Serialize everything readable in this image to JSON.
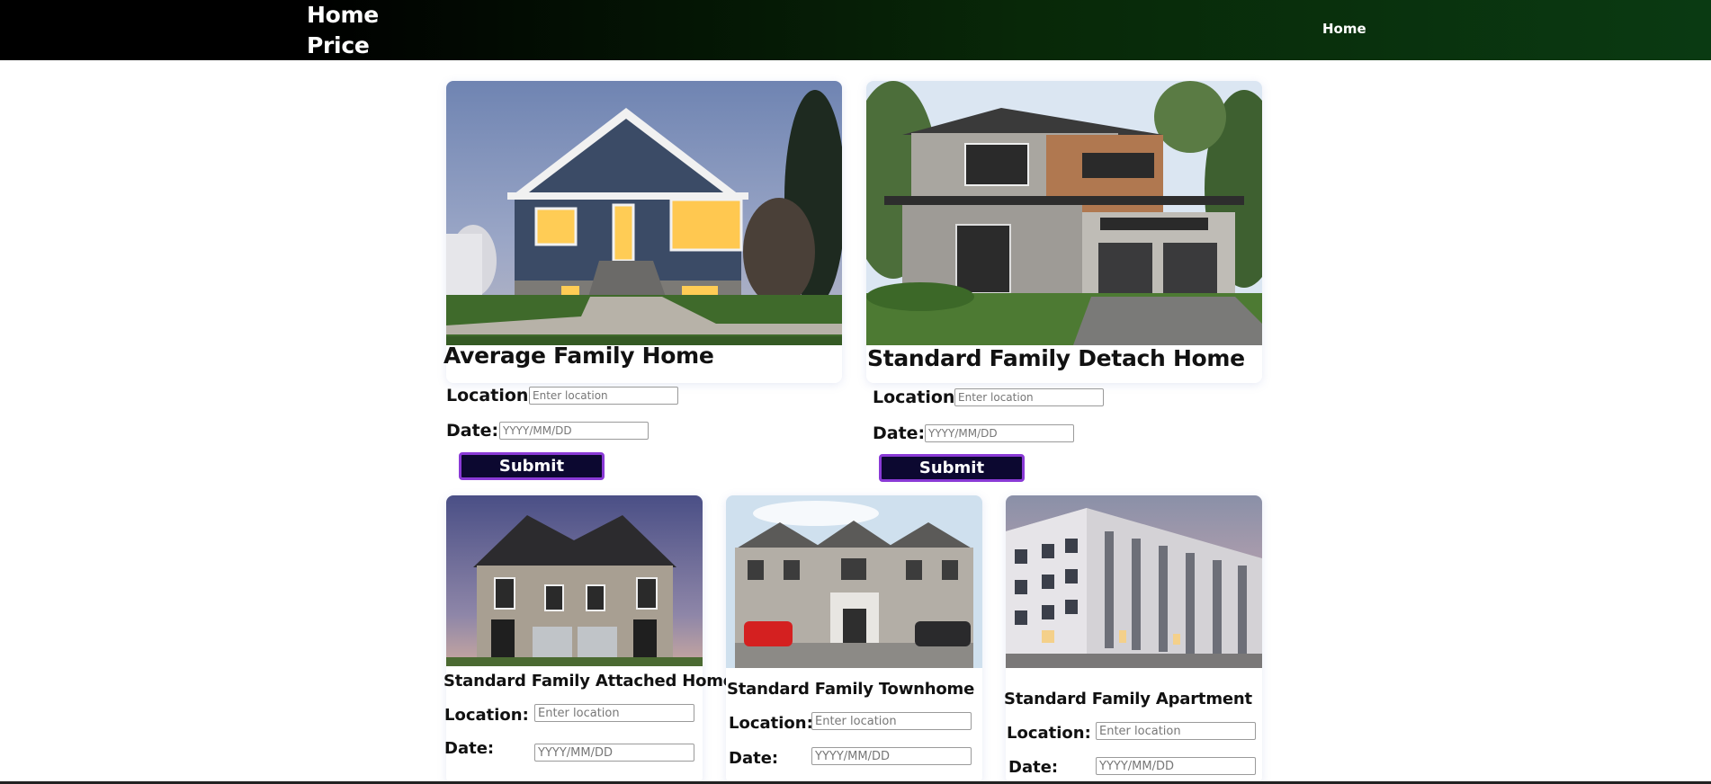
{
  "navbar": {
    "brand": "Home Price Prediction",
    "home_link": "Home"
  },
  "colors": {
    "nav_dark": "#000000",
    "nav_green": "#0a3a12",
    "button_bg": "#0c0830",
    "button_border": "#8a3ad6"
  },
  "cards": [
    {
      "title": "Average Family Home",
      "image_icon": "house-photo",
      "location_label": "Location:",
      "location_placeholder": "Enter location",
      "date_label": "Date:",
      "date_placeholder": "YYYY/MM/DD",
      "submit_label": "Submit"
    },
    {
      "title": "Standard Family Detach Home",
      "image_icon": "house-photo",
      "location_label": "Location:",
      "location_placeholder": "Enter location",
      "date_label": "Date:",
      "date_placeholder": "YYYY/MM/DD",
      "submit_label": "Submit"
    },
    {
      "title": "Standard Family Attached Home",
      "image_icon": "house-photo",
      "location_label": "Location:",
      "location_placeholder": "Enter location",
      "date_label": "Date:",
      "date_placeholder": "YYYY/MM/DD"
    },
    {
      "title": "Standard Family Townhome",
      "image_icon": "townhouse-photo",
      "location_label": "Location:",
      "location_placeholder": "Enter location",
      "date_label": "Date:",
      "date_placeholder": "YYYY/MM/DD"
    },
    {
      "title": "Standard Family Apartment",
      "image_icon": "apartment-photo",
      "location_label": "Location:",
      "location_placeholder": "Enter location",
      "date_label": "Date:",
      "date_placeholder": "YYYY/MM/DD"
    }
  ]
}
